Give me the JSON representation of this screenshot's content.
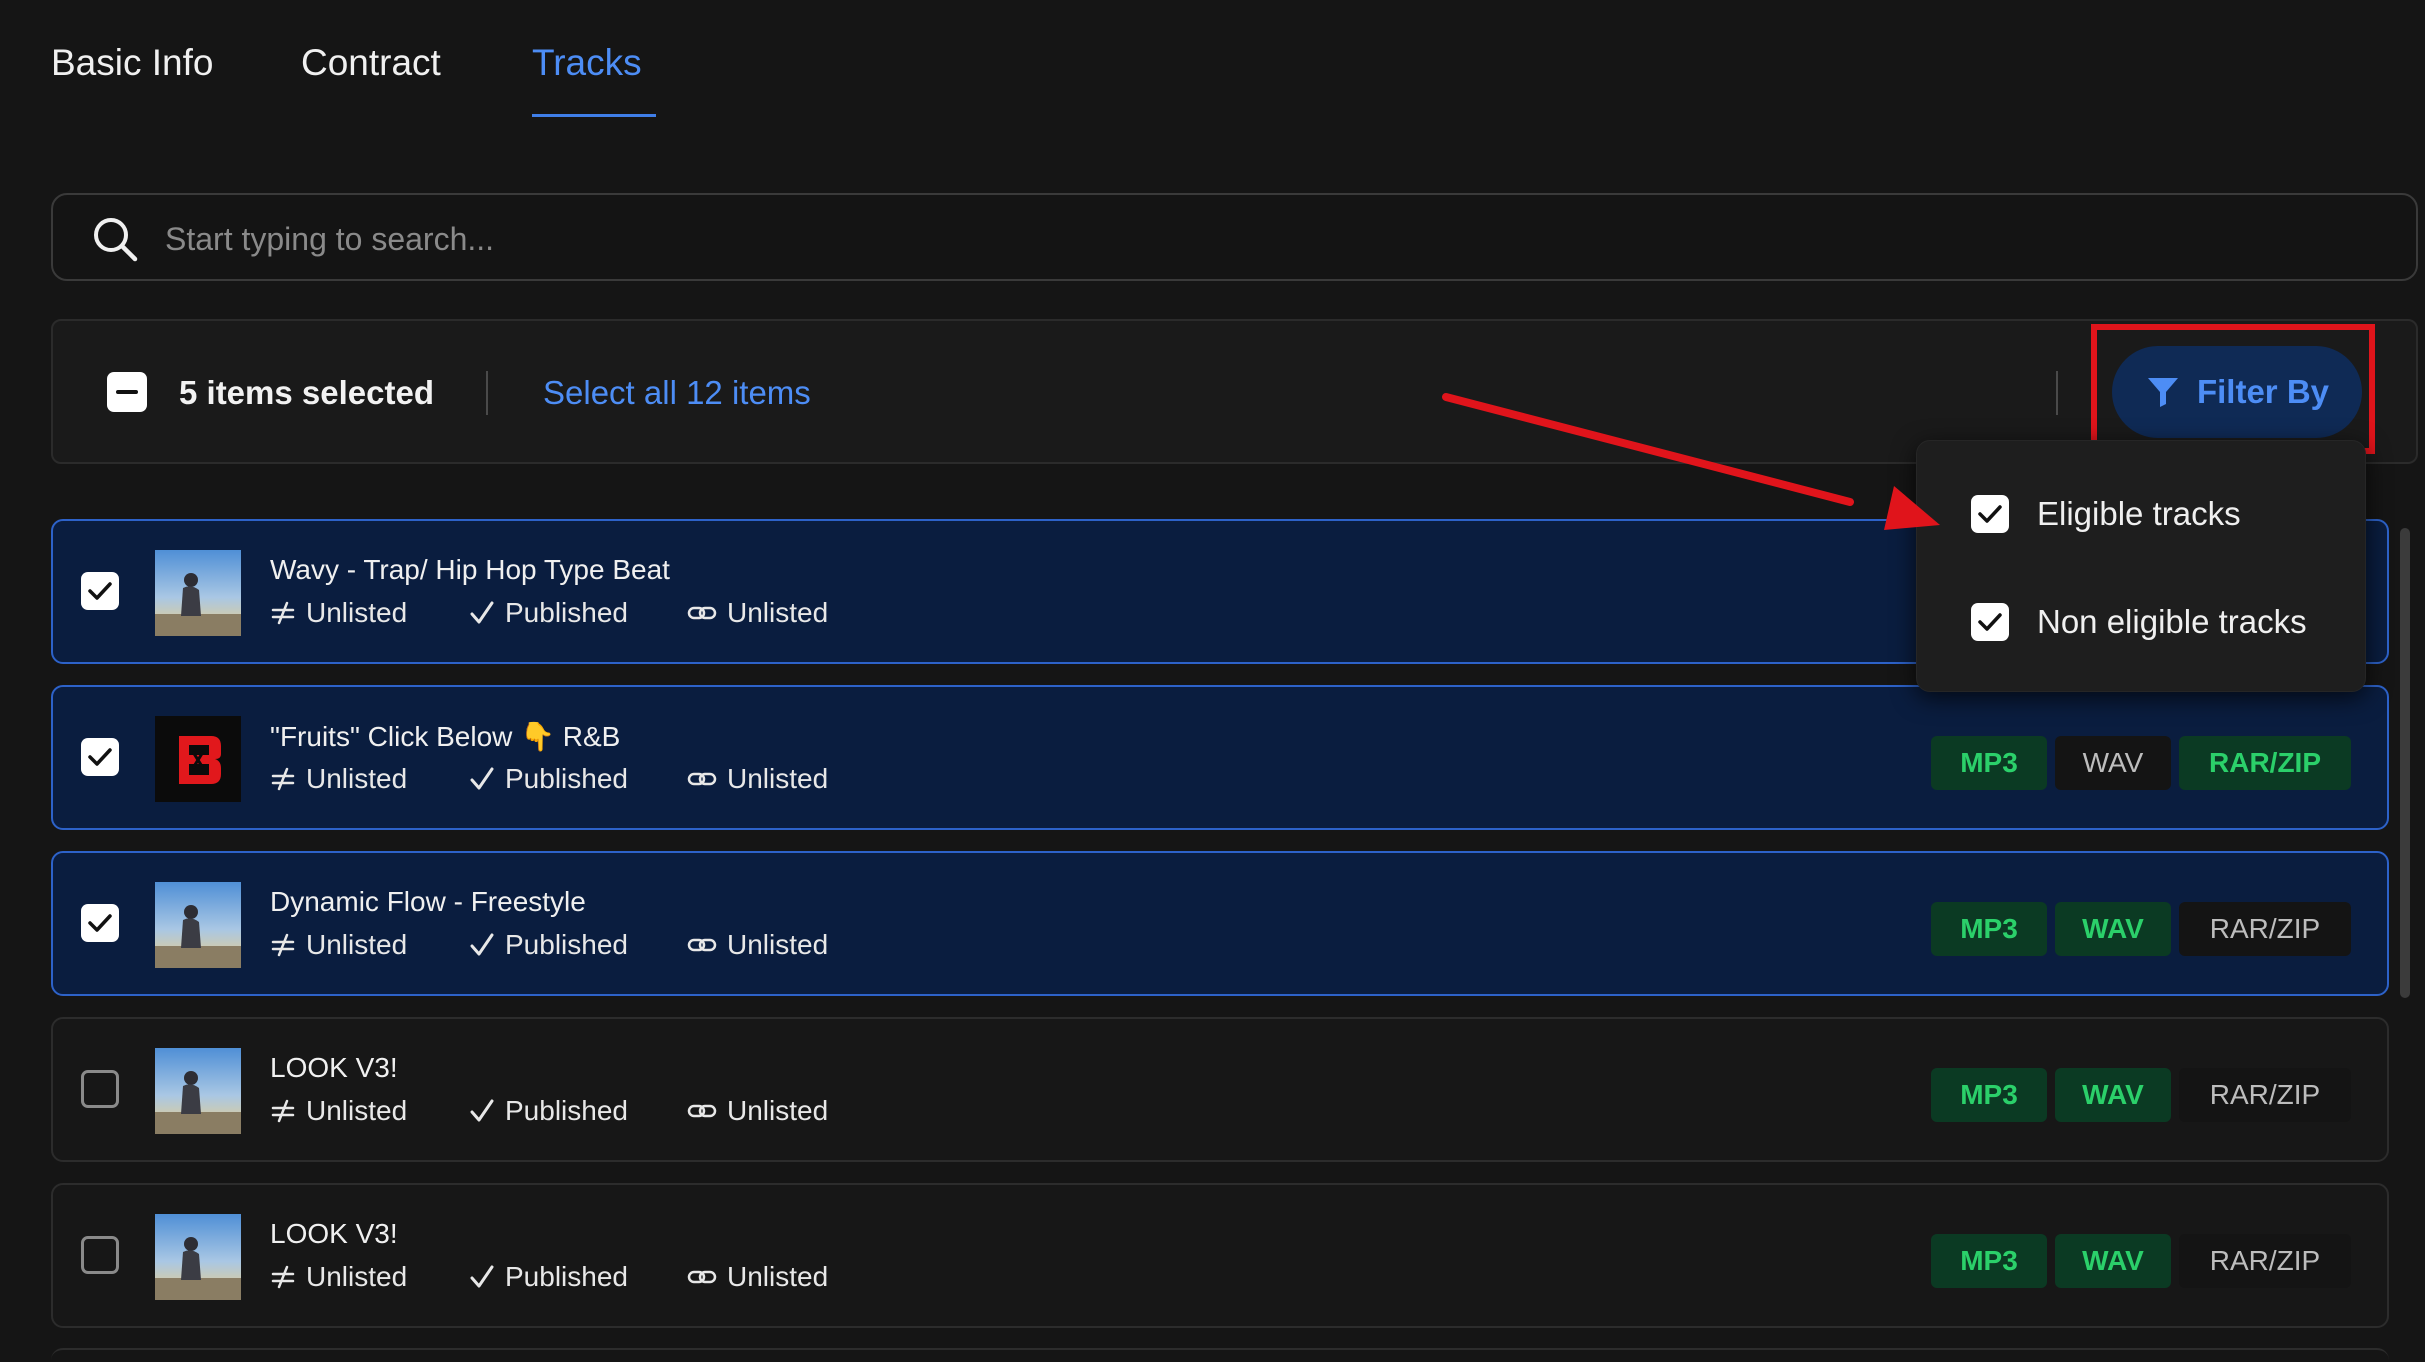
{
  "tabs": [
    {
      "label": "Basic Info"
    },
    {
      "label": "Contract"
    },
    {
      "label": "Tracks"
    }
  ],
  "search": {
    "placeholder": "Start typing to search..."
  },
  "selection": {
    "count_label": "5 items selected",
    "select_all_label": "Select all 12 items"
  },
  "filter": {
    "button_label": "Filter By",
    "options": [
      {
        "label": "Eligible tracks",
        "checked": true
      },
      {
        "label": "Non eligible tracks",
        "checked": true
      }
    ]
  },
  "tracks": [
    {
      "title": "Wavy - Trap/ Hip Hop Type Beat",
      "visibility": "Unlisted",
      "status": "Published",
      "link": "Unlisted",
      "selected": true
    },
    {
      "title": "\"Fruits\" Click Below 👇 R&B",
      "visibility": "Unlisted",
      "status": "Published",
      "link": "Unlisted",
      "selected": true,
      "formats": [
        {
          "label": "MP3",
          "available": true
        },
        {
          "label": "WAV",
          "available": false
        },
        {
          "label": "RAR/ZIP",
          "available": true
        }
      ]
    },
    {
      "title": "Dynamic Flow - Freestyle",
      "visibility": "Unlisted",
      "status": "Published",
      "link": "Unlisted",
      "selected": true,
      "formats": [
        {
          "label": "MP3",
          "available": true
        },
        {
          "label": "WAV",
          "available": true
        },
        {
          "label": "RAR/ZIP",
          "available": false
        }
      ]
    },
    {
      "title": "LOOK V3!",
      "visibility": "Unlisted",
      "status": "Published",
      "link": "Unlisted",
      "selected": false,
      "formats": [
        {
          "label": "MP3",
          "available": true
        },
        {
          "label": "WAV",
          "available": true
        },
        {
          "label": "RAR/ZIP",
          "available": false
        }
      ]
    },
    {
      "title": "LOOK V3!",
      "visibility": "Unlisted",
      "status": "Published",
      "link": "Unlisted",
      "selected": false,
      "formats": [
        {
          "label": "MP3",
          "available": true
        },
        {
          "label": "WAV",
          "available": true
        },
        {
          "label": "RAR/ZIP",
          "available": false
        }
      ]
    }
  ],
  "colors": {
    "accent": "#4d8df5",
    "selected_row_bg": "#0a1d3f",
    "format_available": "#2bd06a",
    "annotation_red": "#e0141b"
  },
  "icons": [
    "search-icon",
    "filter-funnel-icon",
    "checkmark-icon",
    "not-equal-icon",
    "link-icon",
    "annotation-arrow"
  ]
}
